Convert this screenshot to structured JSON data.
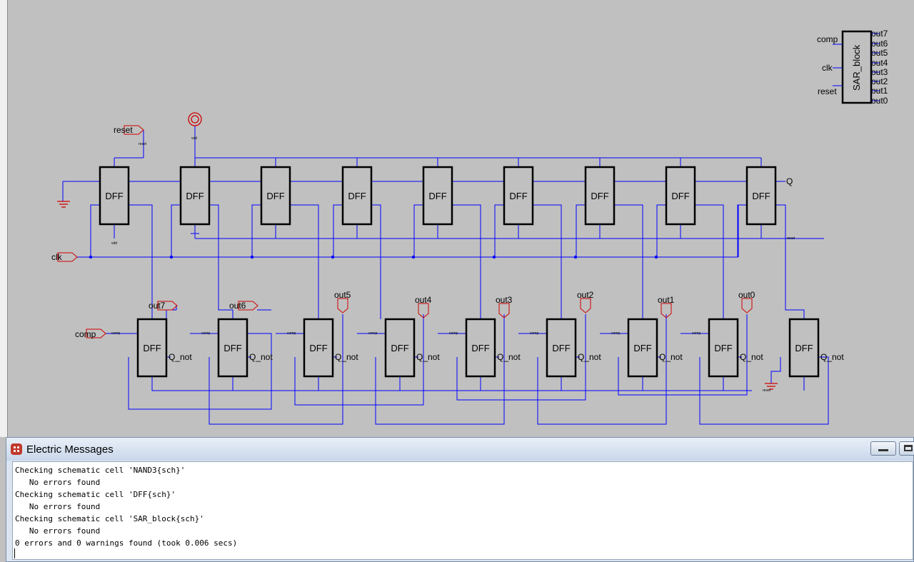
{
  "schematic": {
    "block_title": "SAR_block",
    "block_inputs": [
      "comp",
      "clk",
      "reset"
    ],
    "block_outputs": [
      "out7",
      "out6",
      "out5",
      "out4",
      "out3",
      "out2",
      "out1",
      "out0"
    ],
    "reset_label": "reset",
    "reset_small": "reset",
    "vdd_small": "vdd",
    "clk_label": "clk",
    "comp_label": "comp",
    "comp_small": "comp",
    "q_label": "Q",
    "reset_right_small": "reset",
    "dff_label": "DFF",
    "qnot_label": "Q_not",
    "top_row_count": 9,
    "bottom_row_count": 9,
    "out_labels": [
      "out7",
      "out6",
      "out5",
      "out4",
      "out3",
      "out2",
      "out1",
      "out0"
    ]
  },
  "messages": {
    "window_title": "Electric Messages",
    "lines": [
      "Checking schematic cell 'NAND3{sch}'",
      "   No errors found",
      "Checking schematic cell 'DFF{sch}'",
      "   No errors found",
      "Checking schematic cell 'SAR_block{sch}'",
      "   No errors found",
      "0 errors and 0 warnings found (took 0.006 secs)"
    ]
  },
  "colors": {
    "wire": "#0000ff",
    "export": "#d00000",
    "box": "#000000",
    "background": "#c0c0c0"
  }
}
